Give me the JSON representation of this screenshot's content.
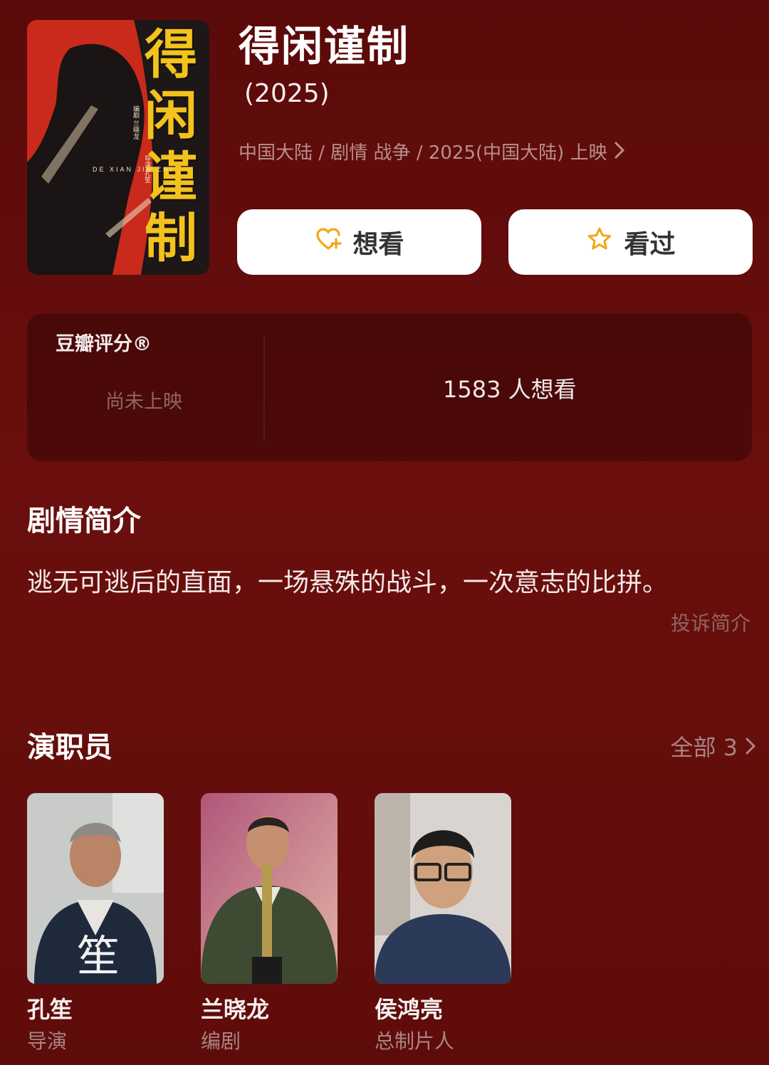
{
  "movie": {
    "title": "得闲谨制",
    "year": "(2025)",
    "meta": "中国大陆 / 剧情 战争 / 2025(中国大陆) 上映",
    "poster": {
      "title_chars": [
        "得",
        "闲",
        "谨",
        "制"
      ],
      "subtitle": "DE XIAN JIN ZHI",
      "credit_left": "编剧 兰晓龙",
      "credit_right": "导演 孔笙",
      "icon": "poster-image"
    }
  },
  "actions": {
    "want_label": "想看",
    "want_icon": "heart-plus-icon",
    "seen_label": "看过",
    "seen_icon": "star-icon"
  },
  "rating": {
    "label": "豆瓣评分®",
    "status": "尚未上映",
    "want_count": "1583 人想看"
  },
  "plot": {
    "title": "剧情简介",
    "text": "逃无可逃后的直面，一场悬殊的战斗，一次意志的比拼。",
    "report_label": "投诉简介"
  },
  "cast": {
    "title": "演职员",
    "all_label": "全部 3",
    "members": [
      {
        "name": "孔笙",
        "role": "导演"
      },
      {
        "name": "兰晓龙",
        "role": "编剧"
      },
      {
        "name": "侯鸿亮",
        "role": "总制片人"
      }
    ]
  },
  "colors": {
    "background": "#5e0c0b",
    "accent_yellow": "#f3b32a",
    "muted_text": "#a98582"
  }
}
